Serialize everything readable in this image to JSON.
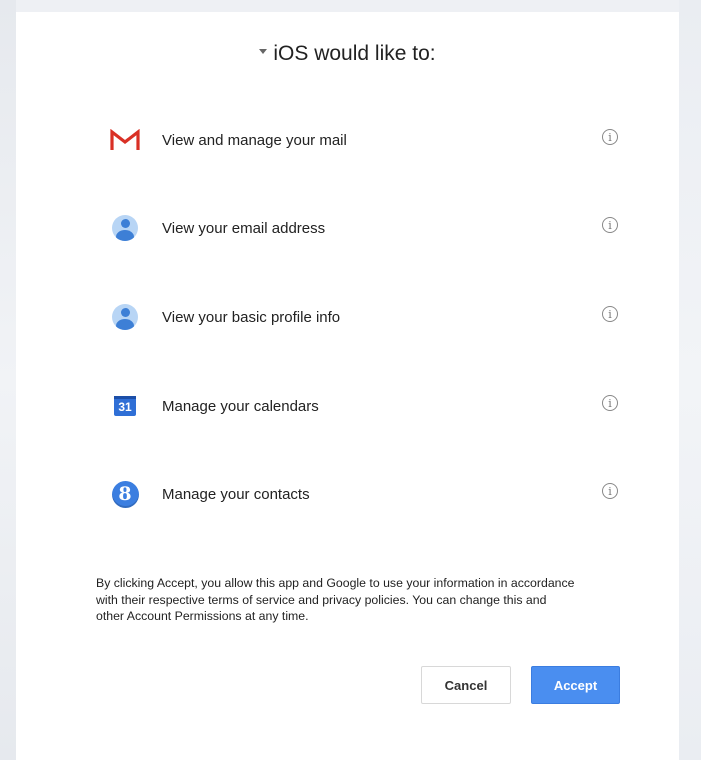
{
  "dialog": {
    "app_name": "iOS",
    "title": "iOS would like to:"
  },
  "permissions": [
    {
      "icon": "gmail-icon",
      "label": "View and manage your mail"
    },
    {
      "icon": "profile-icon",
      "label": "View your email address"
    },
    {
      "icon": "profile-icon",
      "label": "View your basic profile info"
    },
    {
      "icon": "calendar-icon",
      "label": "Manage your calendars",
      "icon_text": "31"
    },
    {
      "icon": "google-plus-icon",
      "label": "Manage your contacts",
      "icon_text": "8"
    }
  ],
  "info_icon_glyph": "i",
  "disclaimer": "By clicking Accept, you allow this app and Google to use your information in accordance with their respective terms of service and privacy policies. You can change this and other Account Permissions at any time.",
  "buttons": {
    "cancel": "Cancel",
    "accept": "Accept"
  },
  "colors": {
    "accept_button": "#4a8ef0",
    "gmail_red": "#d93025",
    "calendar_blue": "#2f6fd6",
    "contacts_blue": "#3b7ee0"
  }
}
